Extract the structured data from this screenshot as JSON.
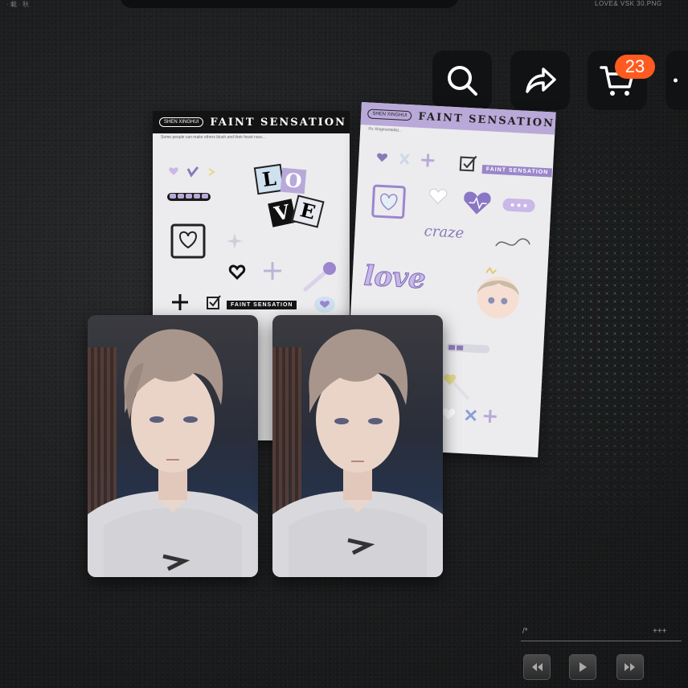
{
  "header": {
    "top_left_text": "· 載 · 秋",
    "top_right_text": "LOVE&  VSK 30.PNG"
  },
  "toolbar": {
    "search_icon": "search-icon",
    "share_icon": "share-icon",
    "cart_icon": "cart-icon",
    "cart_count": "23",
    "more_icon": "more-icon",
    "badge_color": "#ff5a1f"
  },
  "sheets": [
    {
      "brand": "SHEN XINGHUI",
      "title": "FAINT SENSATION",
      "subtitle": "Some people can make others blush and their heart race...",
      "love_letters": [
        "L",
        "O",
        "V",
        "E"
      ],
      "tag": "FAINT SENSATION",
      "header_color": "#131313"
    },
    {
      "brand": "SHEN XINGHUI",
      "title": "FAINT SENSATION",
      "subtitle": "It's Xingmentalist...",
      "tag": "FAINT SENSATION",
      "script_word": "love",
      "cursive_word": "craze",
      "header_color": "#b9a9d9"
    }
  ],
  "cards": [
    {
      "name": "photocard-1"
    },
    {
      "name": "photocard-2"
    }
  ],
  "player": {
    "left_text": "/*",
    "right_text": "+++",
    "prev_icon": "prev-icon",
    "play_icon": "play-icon",
    "next_icon": "next-icon"
  }
}
